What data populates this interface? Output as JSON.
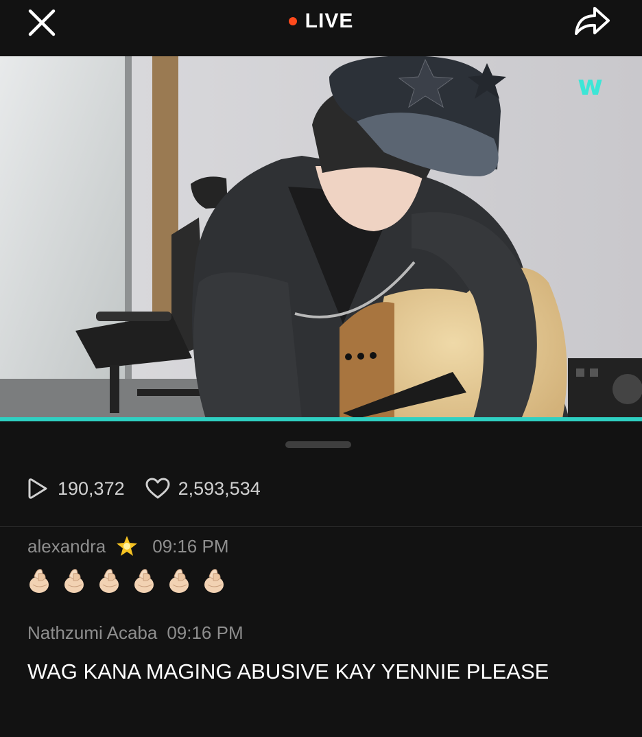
{
  "header": {
    "live_label": "LIVE",
    "live_dot_color": "#ff4a1c",
    "close_icon": "close-icon",
    "share_icon": "share-icon"
  },
  "video": {
    "watermark_text": "w",
    "accent_color": "#2fd0c2"
  },
  "stats": {
    "views": "190,372",
    "likes": "2,593,534",
    "views_icon": "play-icon",
    "likes_icon": "heart-icon"
  },
  "comments": [
    {
      "author": "alexandra",
      "badge_icon": "glowing-star-icon",
      "time": "09:16 PM",
      "emojis": [
        "finger-heart",
        "finger-heart",
        "finger-heart",
        "finger-heart",
        "finger-heart",
        "finger-heart"
      ]
    },
    {
      "author": "Nathzumi Acaba",
      "time": "09:16 PM",
      "text": "WAG KANA MAGING ABUSIVE KAY YENNIE PLEASE"
    }
  ]
}
